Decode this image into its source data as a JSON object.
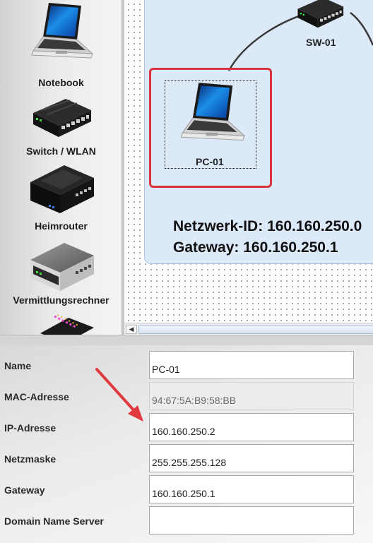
{
  "palette": {
    "items": [
      {
        "label": "Notebook",
        "icon": "notebook-icon"
      },
      {
        "label": "Switch / WLAN",
        "icon": "switch-icon"
      },
      {
        "label": "Heimrouter",
        "icon": "home-router-icon"
      },
      {
        "label": "Vermittlungsrechner",
        "icon": "router-icon"
      }
    ]
  },
  "canvas": {
    "network_id_text": "Netzwerk-ID: 160.160.250.0",
    "gateway_text": "Gateway: 160.160.250.1",
    "devices": {
      "pc": {
        "label": "PC-01",
        "icon": "notebook-icon"
      },
      "switch": {
        "label": "SW-01",
        "icon": "switch-icon"
      }
    },
    "selection_color": "#d9343c",
    "network_bg": "#dbe9f9"
  },
  "properties": {
    "name_label": "Name",
    "name_value": "PC-01",
    "mac_label": "MAC-Adresse",
    "mac_value": "94:67:5A:B9:58:BB",
    "ip_label": "IP-Adresse",
    "ip_value": "160.160.250.2",
    "netmask_label": "Netzmaske",
    "netmask_value": "255.255.255.128",
    "gateway_label": "Gateway",
    "gateway_value": "160.160.250.1",
    "dns_label": "Domain Name Server",
    "dns_value": ""
  },
  "annotation": {
    "arrow_color": "#e0393e"
  }
}
